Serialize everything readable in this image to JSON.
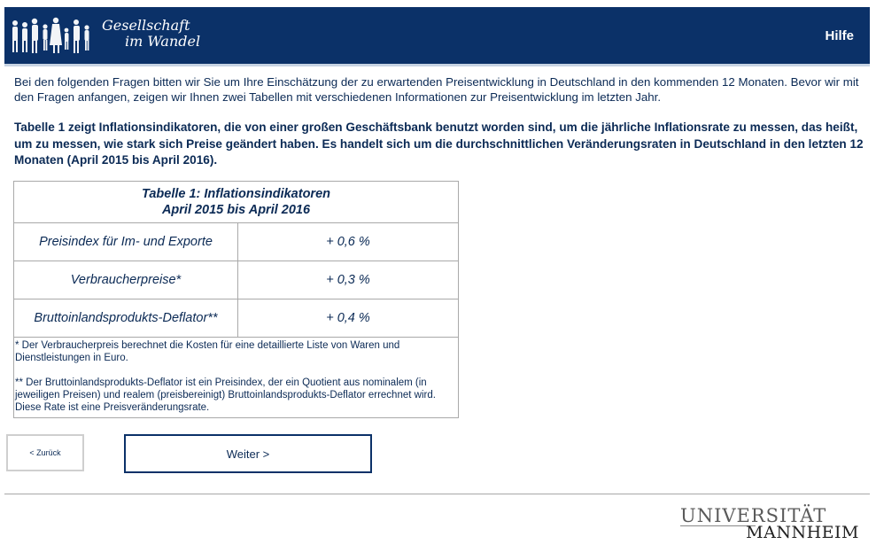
{
  "header": {
    "logo_line1": "Gesellschaft",
    "logo_line2": "im Wandel",
    "help_label": "Hilfe",
    "brand_color": "#0b3168"
  },
  "intro": {
    "text": "Bei den folgenden Fragen bitten wir Sie um Ihre Einschätzung der zu erwartenden Preisentwicklung in Deutschland in den kommenden 12 Monaten. Bevor wir mit den Fragen anfangen, zeigen wir Ihnen zwei Tabellen mit verschiedenen Informationen zur Preisentwicklung im letzten Jahr.",
    "lead": "Tabelle 1 zeigt Inflationsindikatoren, die von einer großen Geschäftsbank benutzt worden sind, um die jährliche Inflationsrate zu messen, das heißt, um zu messen, wie stark sich Preise geändert haben. Es handelt sich um die durchschnittlichen Veränderungsraten in Deutschland in den letzten 12 Monaten (April 2015 bis April 2016)."
  },
  "table": {
    "title_line1": "Tabelle 1: Inflationsindikatoren",
    "title_line2": "April 2015 bis April 2016",
    "rows": [
      {
        "label": "Preisindex für Im- und Exporte",
        "value": "+ 0,6 %"
      },
      {
        "label": "Verbraucherpreise*",
        "value": "+ 0,3 %"
      },
      {
        "label": "Bruttoinlandsprodukts-Deflator**",
        "value": "+ 0,4 %"
      }
    ],
    "note1": "* Der Verbraucherpreis berechnet die Kosten für eine detaillierte Liste von Waren und Dienstleistungen in Euro.",
    "note2": "** Der Bruttoinlandsprodukts-Deflator ist ein Preisindex, der ein Quotient aus nominalem (in jeweiligen Preisen) und realem (preisbereinigt) Bruttoinlandsprodukts-Deflator errechnet wird. Diese Rate ist eine Preisveränderungsrate."
  },
  "nav": {
    "back_label": "< Zurück",
    "next_label": "Weiter >"
  },
  "footer": {
    "uni_line1": "UNIVERSITÄT",
    "uni_line2": "MANNHEIM"
  }
}
